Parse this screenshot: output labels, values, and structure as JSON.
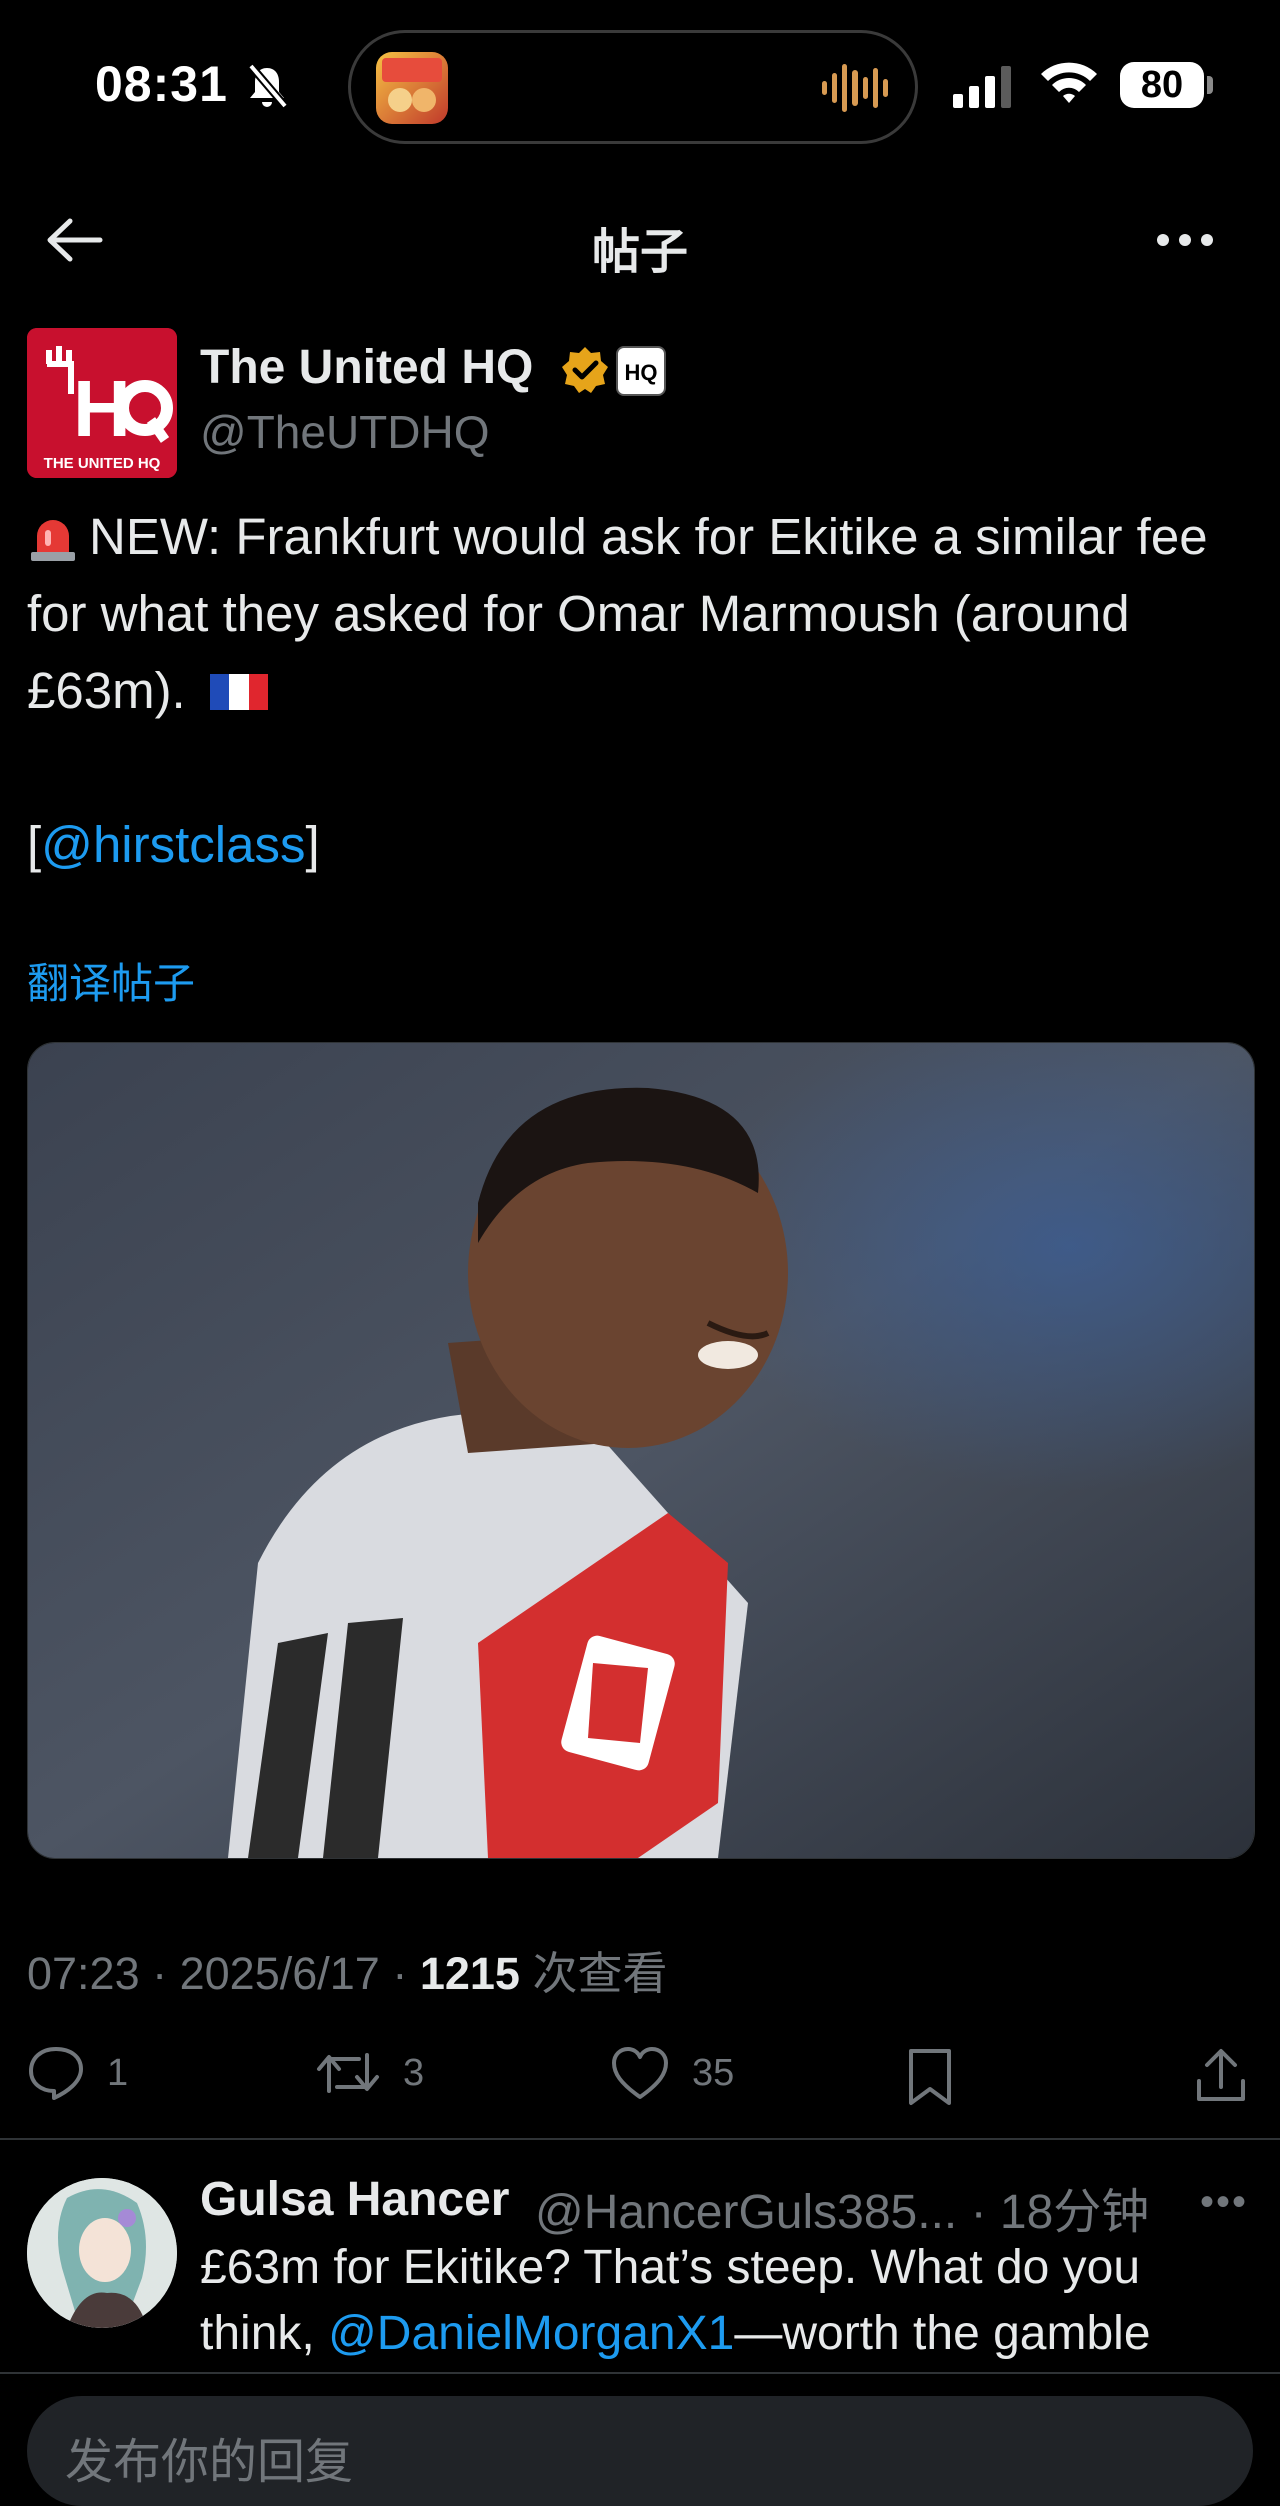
{
  "status_bar": {
    "time": "08:31",
    "battery": "80"
  },
  "header": {
    "title": "帖子"
  },
  "tweet": {
    "author_name": "The United HQ",
    "author_handle": "@TheUTDHQ",
    "avatar_brand": "THE UNITED HQ",
    "affiliate_badge": "HQ",
    "text_main": "NEW: Frankfurt would ask for Ekitike a similar fee for what they asked for Omar Marmoush (around £63m).",
    "text_bracket_open": "[",
    "mention": "@hirstclass",
    "text_bracket_close": "]",
    "translate_link": "翻译帖子",
    "time": "07:23",
    "date": "2025/6/17",
    "views_count": "1215",
    "views_label": "次查看",
    "replies": "1",
    "reposts": "3",
    "likes": "35"
  },
  "reply": {
    "name": "Gulsa Hancer",
    "handle": "@HancerGuls385...",
    "time": "· 18分钟",
    "text_before": "£63m for Ekitike? That’s steep. What do you think, ",
    "mention": "@DanielMorganX1",
    "text_after": "—worth the gamble"
  },
  "composer": {
    "placeholder": "发布你的回复"
  }
}
